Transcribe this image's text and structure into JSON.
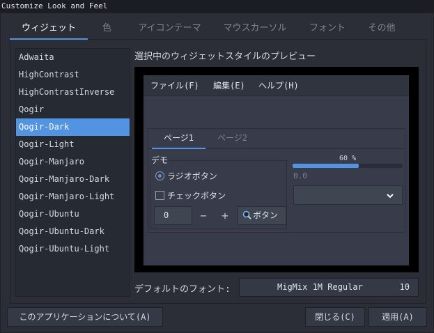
{
  "window": {
    "title": "Customize Look and Feel"
  },
  "tabs": [
    {
      "label": "ウィジェット"
    },
    {
      "label": "色"
    },
    {
      "label": "アイコンテーマ"
    },
    {
      "label": "マウスカーソル"
    },
    {
      "label": "フォント"
    },
    {
      "label": "その他"
    }
  ],
  "active_tab": "ウィジェット",
  "theme_list": {
    "items": [
      "Adwaita",
      "HighContrast",
      "HighContrastInverse",
      "Qogir",
      "Qogir-Dark",
      "Qogir-Light",
      "Qogir-Manjaro",
      "Qogir-Manjaro-Dark",
      "Qogir-Manjaro-Light",
      "Qogir-Ubuntu",
      "Qogir-Ubuntu-Dark",
      "Qogir-Ubuntu-Light"
    ],
    "selected": "Qogir-Dark"
  },
  "preview": {
    "label": "選択中のウィジェットスタイルのプレビュー",
    "menu": [
      "ファイル(F)",
      "編集(E)",
      "ヘルプ(H)"
    ],
    "notebook_tabs": [
      "ページ1",
      "ページ2"
    ],
    "frame_label": "デモ",
    "radio_label": "ラジオボタン",
    "check_label": "チェックボタン",
    "spin_value": "0",
    "spin_minus": "−",
    "spin_plus": "+",
    "button_label": "ボタン",
    "progress_text": "60 %",
    "progress_value": 60,
    "slider_value": "0.0"
  },
  "font": {
    "label": "デフォルトのフォント:",
    "name": "MigMix 1M Regular",
    "size": "10"
  },
  "buttons": {
    "about": "このアプリケーションについて(A)",
    "close": "閉じる(C)",
    "apply": "適用(A)"
  },
  "colors": {
    "accent": "#5294e2",
    "background": "#2b2e37"
  }
}
